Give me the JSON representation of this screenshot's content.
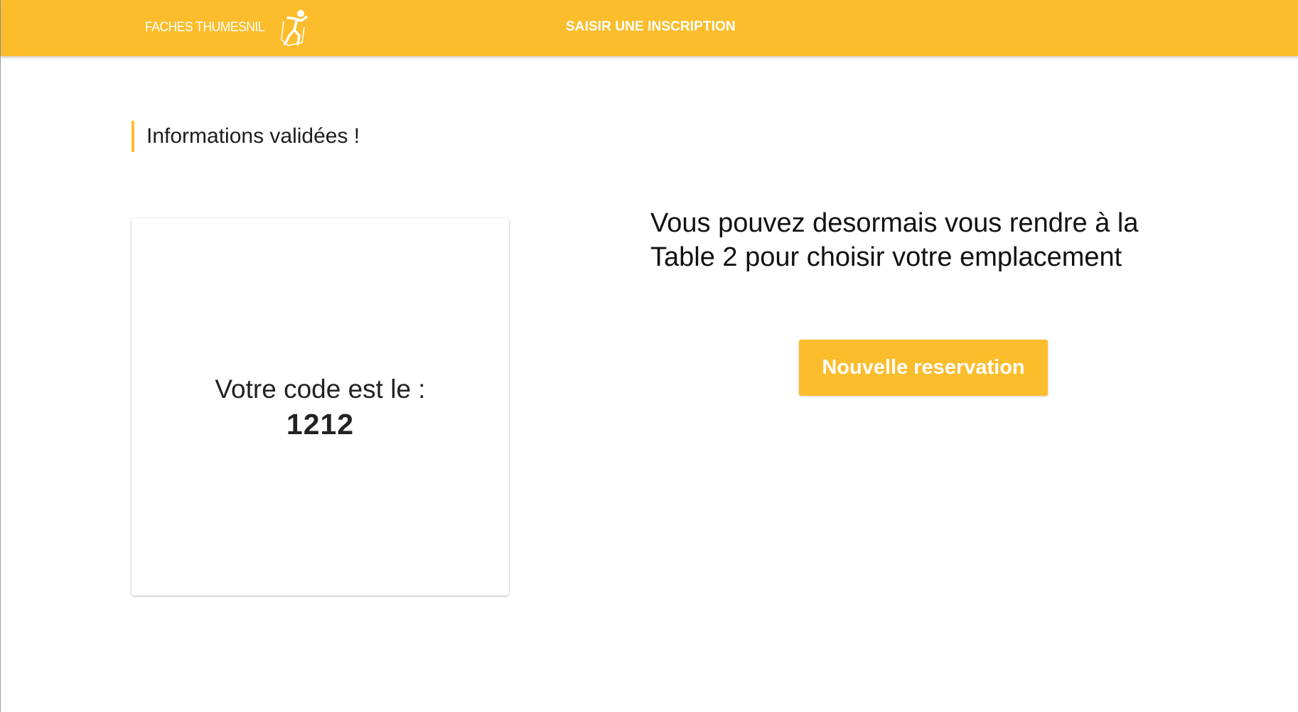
{
  "colors": {
    "brand": "#fbbd2c",
    "text": "#1d1d1d",
    "header_text": "#ffffff"
  },
  "header": {
    "logo_text": "FACHES THUMESNIL",
    "logo_icon": "runner-figure-icon",
    "nav_link": "SAISIR UNE INSCRIPTION"
  },
  "main": {
    "status_title": "Informations validées !",
    "code_label": "Votre code est le :",
    "code_value": "1212",
    "instruction": "Vous pouvez desormais vous rendre à la Table 2 pour choisir votre emplacement",
    "new_reservation_label": "Nouvelle reservation"
  }
}
